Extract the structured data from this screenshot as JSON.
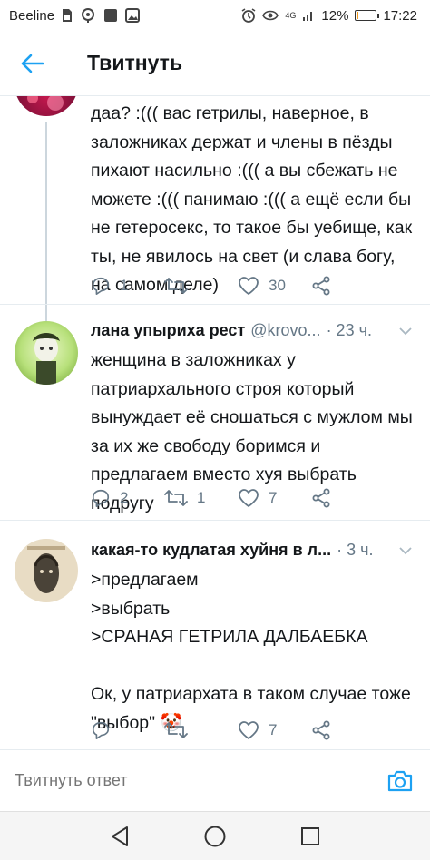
{
  "status_bar": {
    "carrier": "Beeline",
    "network": "4G",
    "battery": "12%",
    "battery_level": 0.12,
    "time": "17:22"
  },
  "header": {
    "title": "Твитнуть",
    "back_icon": "arrow-left-icon"
  },
  "tweets": [
    {
      "name": "",
      "handle": "",
      "time": "",
      "text": "даа? :((( вас гетрилы, наверное, в заложниках держат и члены в пёзды пихают насильно :((( а вы сбежать не можете :((( панимаю :((( а ещё если бы не гетеросекс, то такое бы уебище, как ты, не явилось на свет (и слава богу, на самом деле)",
      "replies": "1",
      "retweets": "",
      "likes": "30"
    },
    {
      "name": "лана упыриха рест",
      "handle": "@krovo...",
      "time": "· 23 ч.",
      "text": "женщина в заложниках у патриархального строя который вынуждает её сношаться с мужлом мы за их же свободу боримся и предлагаем вместо хуя выбрать подругу",
      "replies": "2",
      "retweets": "1",
      "likes": "7"
    },
    {
      "name": "какая-то кудлатая хуйня в л...",
      "handle": "",
      "time": "· 3 ч.",
      "text": ">предлагаем\n>выбрать\n>СРАНАЯ ГЕТРИЛА ДАЛБАЕБКА\n\nОк, у патриархата в таком случае тоже \"выбор\" 🤡",
      "replies": "",
      "retweets": "",
      "likes": "7"
    }
  ],
  "reply_bar": {
    "placeholder": "Твитнуть ответ",
    "camera_icon": "camera-icon"
  },
  "nav_bar": {
    "back_icon": "triangle-back-icon",
    "home_icon": "circle-home-icon",
    "recents_icon": "square-recents-icon"
  },
  "colors": {
    "accent": "#1da1f2",
    "text": "#14171a",
    "secondary": "#657786",
    "divider": "#e6ecf0"
  }
}
